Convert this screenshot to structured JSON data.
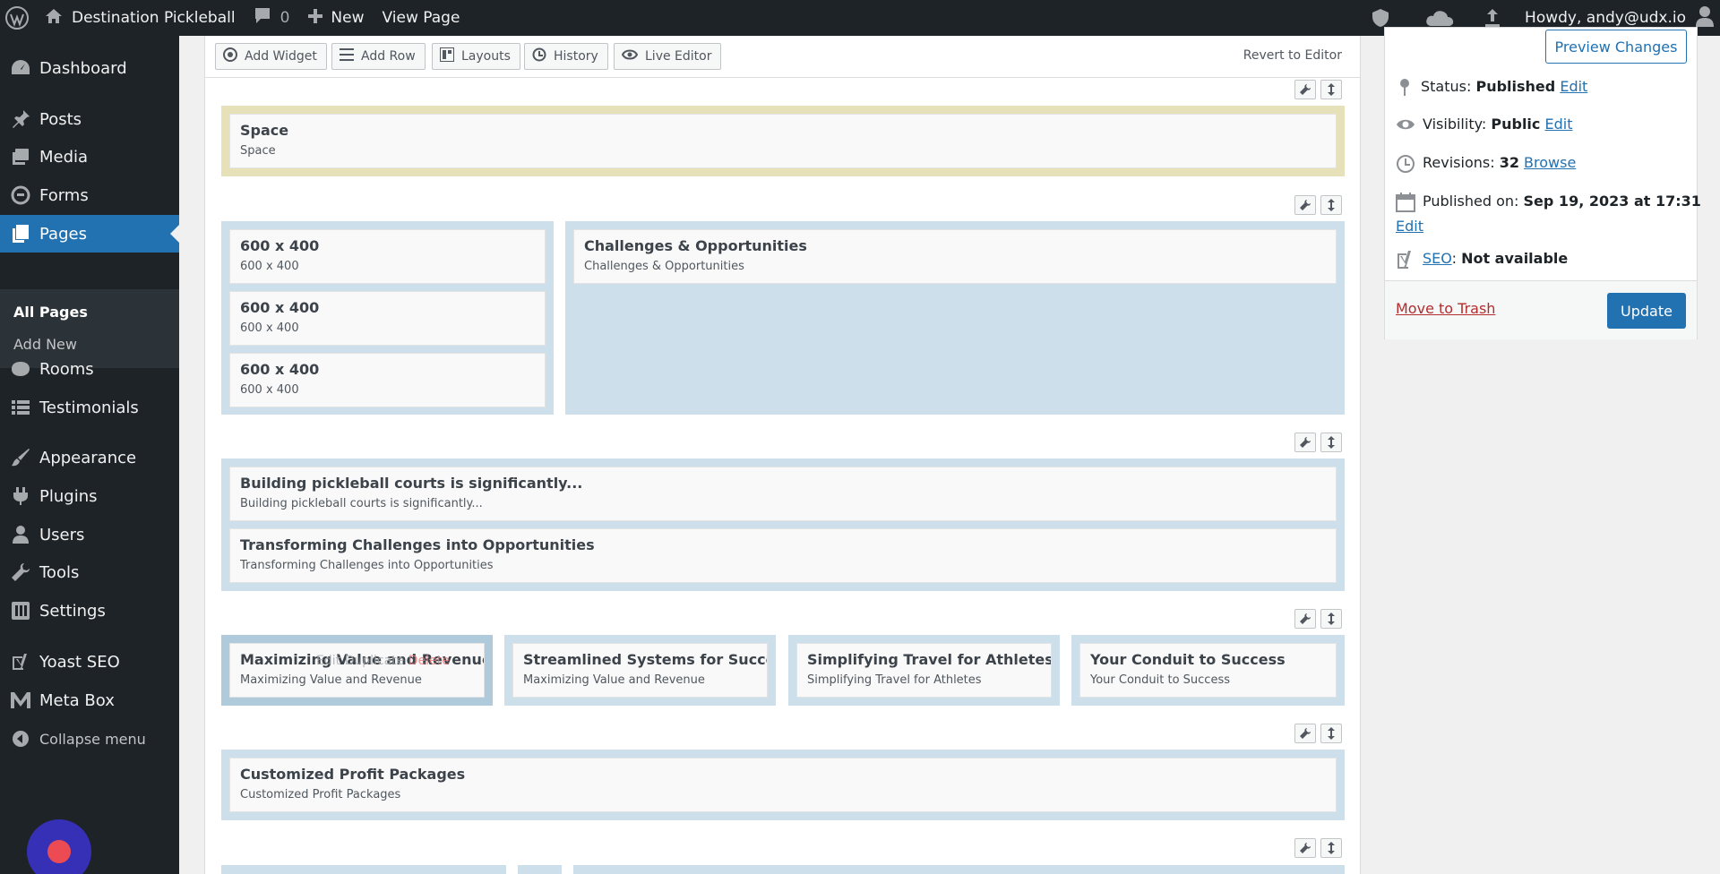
{
  "admin_bar": {
    "site_name": "Destination Pickleball",
    "comments_count": "0",
    "new_label": "New",
    "view_page_label": "View Page",
    "greeting": "Howdy, andy@udx.io"
  },
  "sidebar": {
    "items": {
      "dashboard": "Dashboard",
      "posts": "Posts",
      "media": "Media",
      "forms": "Forms",
      "pages": "Pages",
      "rooms": "Rooms",
      "testimonials": "Testimonials",
      "appearance": "Appearance",
      "plugins": "Plugins",
      "users": "Users",
      "tools": "Tools",
      "settings": "Settings",
      "yoast": "Yoast SEO",
      "metabox": "Meta Box",
      "collapse": "Collapse menu"
    },
    "submenu": {
      "all_pages": "All Pages",
      "add_new": "Add New"
    }
  },
  "builder": {
    "toolbar": {
      "add_widget": "Add Widget",
      "add_row": "Add Row",
      "layouts": "Layouts",
      "history": "History",
      "live_editor": "Live Editor",
      "revert": "Revert to Editor"
    },
    "widgets": {
      "space": {
        "title": "Space",
        "sub": "Space"
      },
      "img1": {
        "title": "600 x 400",
        "sub": "600 x 400"
      },
      "img2": {
        "title": "600 x 400",
        "sub": "600 x 400"
      },
      "img3": {
        "title": "600 x 400",
        "sub": "600 x 400"
      },
      "challenges": {
        "title": "Challenges & Opportunities",
        "sub": "Challenges & Opportunities"
      },
      "building": {
        "title": "Building pickleball courts is significantly...",
        "sub": "Building pickleball courts is significantly..."
      },
      "transforming": {
        "title": "Transforming Challenges into Opportunities",
        "sub": "Transforming Challenges into Opportunities"
      },
      "maximizing": {
        "title": "Maximizing Value and Revenue",
        "sub": "Maximizing Value and Revenue"
      },
      "streamlined": {
        "title": "Streamlined Systems for Success",
        "sub": "Maximizing Value and Revenue"
      },
      "travel": {
        "title": "Simplifying Travel for Athletes",
        "sub": "Simplifying Travel for Athletes"
      },
      "conduit": {
        "title": "Your Conduit to Success",
        "sub": "Your Conduit to Success"
      },
      "profit": {
        "title": "Customized Profit Packages",
        "sub": "Customized Profit Packages"
      }
    },
    "hover_actions": {
      "edit": "Edit",
      "duplicate": "Duplicate",
      "delete": "Delete"
    }
  },
  "publish": {
    "preview_label": "Preview Changes",
    "status_label": "Status:",
    "status_value": "Published",
    "visibility_label": "Visibility:",
    "visibility_value": "Public",
    "revisions_label": "Revisions:",
    "revisions_value": "32",
    "browse_label": "Browse",
    "published_on_label": "Published on:",
    "published_on_value": "Sep 19, 2023 at 17:31",
    "edit_label": "Edit",
    "seo_label": "SEO",
    "seo_value": "Not available",
    "trash_label": "Move to Trash",
    "update_label": "Update"
  },
  "colors": {
    "accent": "#2271b1",
    "row_highlight": "#e6e1b8",
    "row_selected": "#cddfea",
    "admin_dark": "#1d2327"
  }
}
